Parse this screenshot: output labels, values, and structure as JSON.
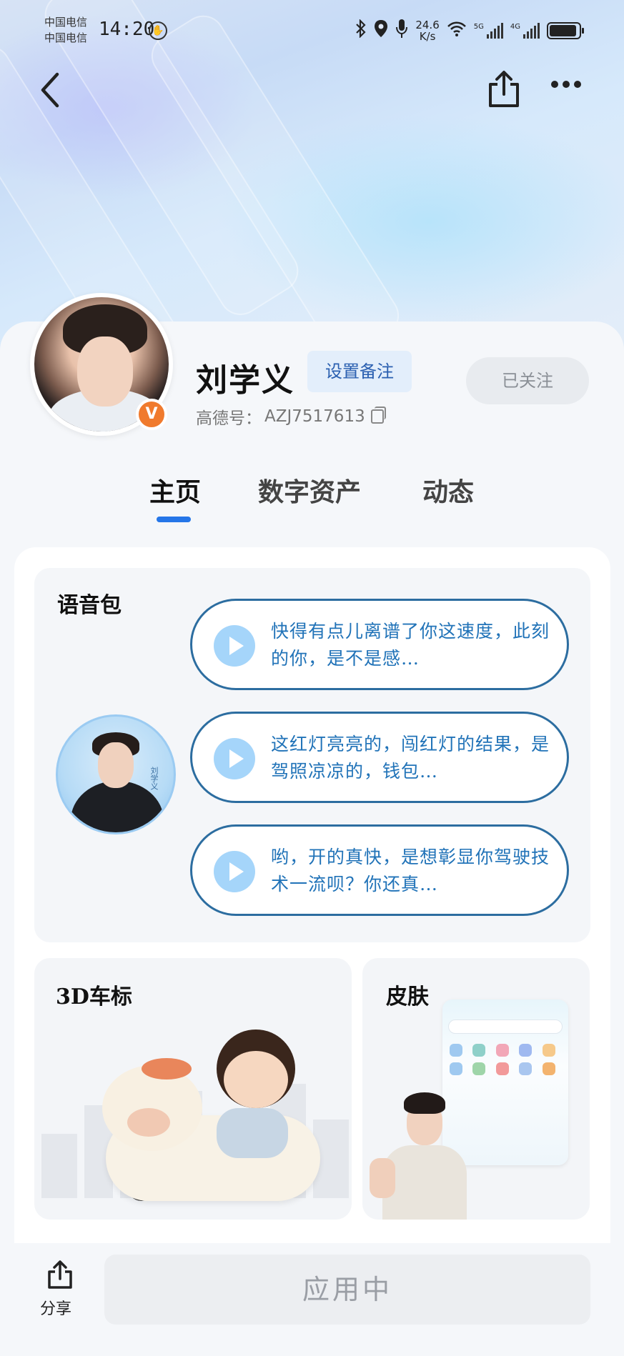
{
  "status_bar": {
    "carrier_1": "中国电信",
    "carrier_2": "中国电信",
    "time": "14:20",
    "net_speed_value": "24.6",
    "net_speed_unit": "K/s",
    "signal_1_label": "5G",
    "signal_2_label": "4G"
  },
  "profile": {
    "name": "刘学义",
    "remark_button": "设置备注",
    "gaode_id_label": "高德号：",
    "gaode_id_value": "AZJ7517613",
    "follow_button": "已关注",
    "verified_badge": "V"
  },
  "tabs": [
    {
      "label": "主页",
      "active": true
    },
    {
      "label": "数字资产",
      "active": false
    },
    {
      "label": "动态",
      "active": false
    }
  ],
  "voice_pack": {
    "title": "语音包",
    "avatar_name": "刘学义",
    "items": [
      {
        "text": "快得有点儿离谱了你这速度，此刻的你，是不是感…"
      },
      {
        "text": "这红灯亮亮的，闯红灯的结果，是驾照凉凉的，钱包…"
      },
      {
        "text": "哟，开的真快，是想彰显你驾驶技术一流呗？你还真…"
      }
    ]
  },
  "car_logo": {
    "title": "3D车标"
  },
  "skin": {
    "title": "皮肤"
  },
  "bottom": {
    "share_label": "分享",
    "apply_button": "应用中"
  },
  "colors": {
    "accent": "#2576e8",
    "voice_text": "#2173b8",
    "voice_border": "#2c6da0",
    "badge": "#f07a2d"
  }
}
